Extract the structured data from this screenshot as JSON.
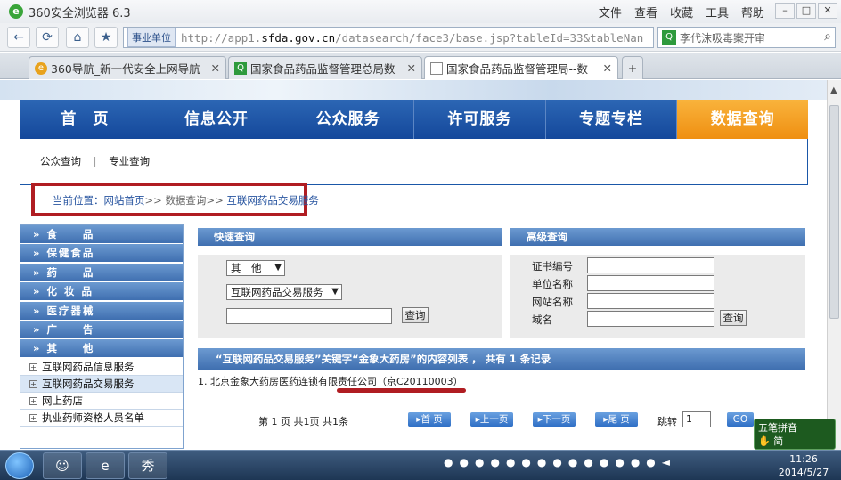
{
  "browser": {
    "title": "360安全浏览器 6.3",
    "menu": [
      "文件",
      "查看",
      "收藏",
      "工具",
      "帮助"
    ],
    "address_tag": "事业单位",
    "url_prefix": "http://app1.",
    "url_domain": "sfda.gov.cn",
    "url_rest": "/datasearch/face3/base.jsp?tableId=33&tableNan",
    "search_placeholder": "李代沫吸毒案开审",
    "tabs": [
      {
        "label": "360导航_新一代安全上网导航"
      },
      {
        "label": "国家食品药品监督管理总局数"
      },
      {
        "label": "国家食品药品监督管理局--数"
      }
    ]
  },
  "site": {
    "main_nav": [
      "首　页",
      "信息公开",
      "公众服务",
      "许可服务",
      "专题专栏",
      "数据查询"
    ],
    "sub_nav": [
      "公众查询",
      "专业查询"
    ],
    "breadcrumb": {
      "prefix": "当前位置：",
      "home": "网站首页",
      "mid": "数据查询",
      "current": "互联网药品交易服务",
      "sep": ">>"
    },
    "categories": [
      "食　　品",
      "保健食品",
      "药　　品",
      "化 妆 品",
      "医疗器械",
      "广　　告",
      "其　　他"
    ],
    "sub_items": [
      "互联网药品信息服务",
      "互联网药品交易服务",
      "网上药店",
      "执业药师资格人员名单"
    ],
    "quick_search": {
      "title": "快速查询",
      "select1": "其　他",
      "select2": "互联网药品交易服务",
      "button": "查询"
    },
    "advanced_search": {
      "title": "高级查询",
      "fields": [
        "证书编号",
        "单位名称",
        "网站名称",
        "域名"
      ],
      "button": "查询"
    },
    "results": {
      "summary": "“互联网药品交易服务”关键字“金象大药房”的内容列表 ， 共有 1 条记录",
      "rows": [
        "1. 北京金象大药房医药连锁有限责任公司（京C20110003）"
      ]
    },
    "pager": {
      "info": "第 1 页 共1页 共1条",
      "first": "首 页",
      "prev": "上一页",
      "next": "下一页",
      "last": "尾 页",
      "jump_label": "跳转",
      "jump_value": "1",
      "go": "GO"
    }
  },
  "taskbar": {
    "time": "11:26",
    "date": "2014/5/27",
    "ime_label": "五笔拼音",
    "ime_sub": "简"
  }
}
